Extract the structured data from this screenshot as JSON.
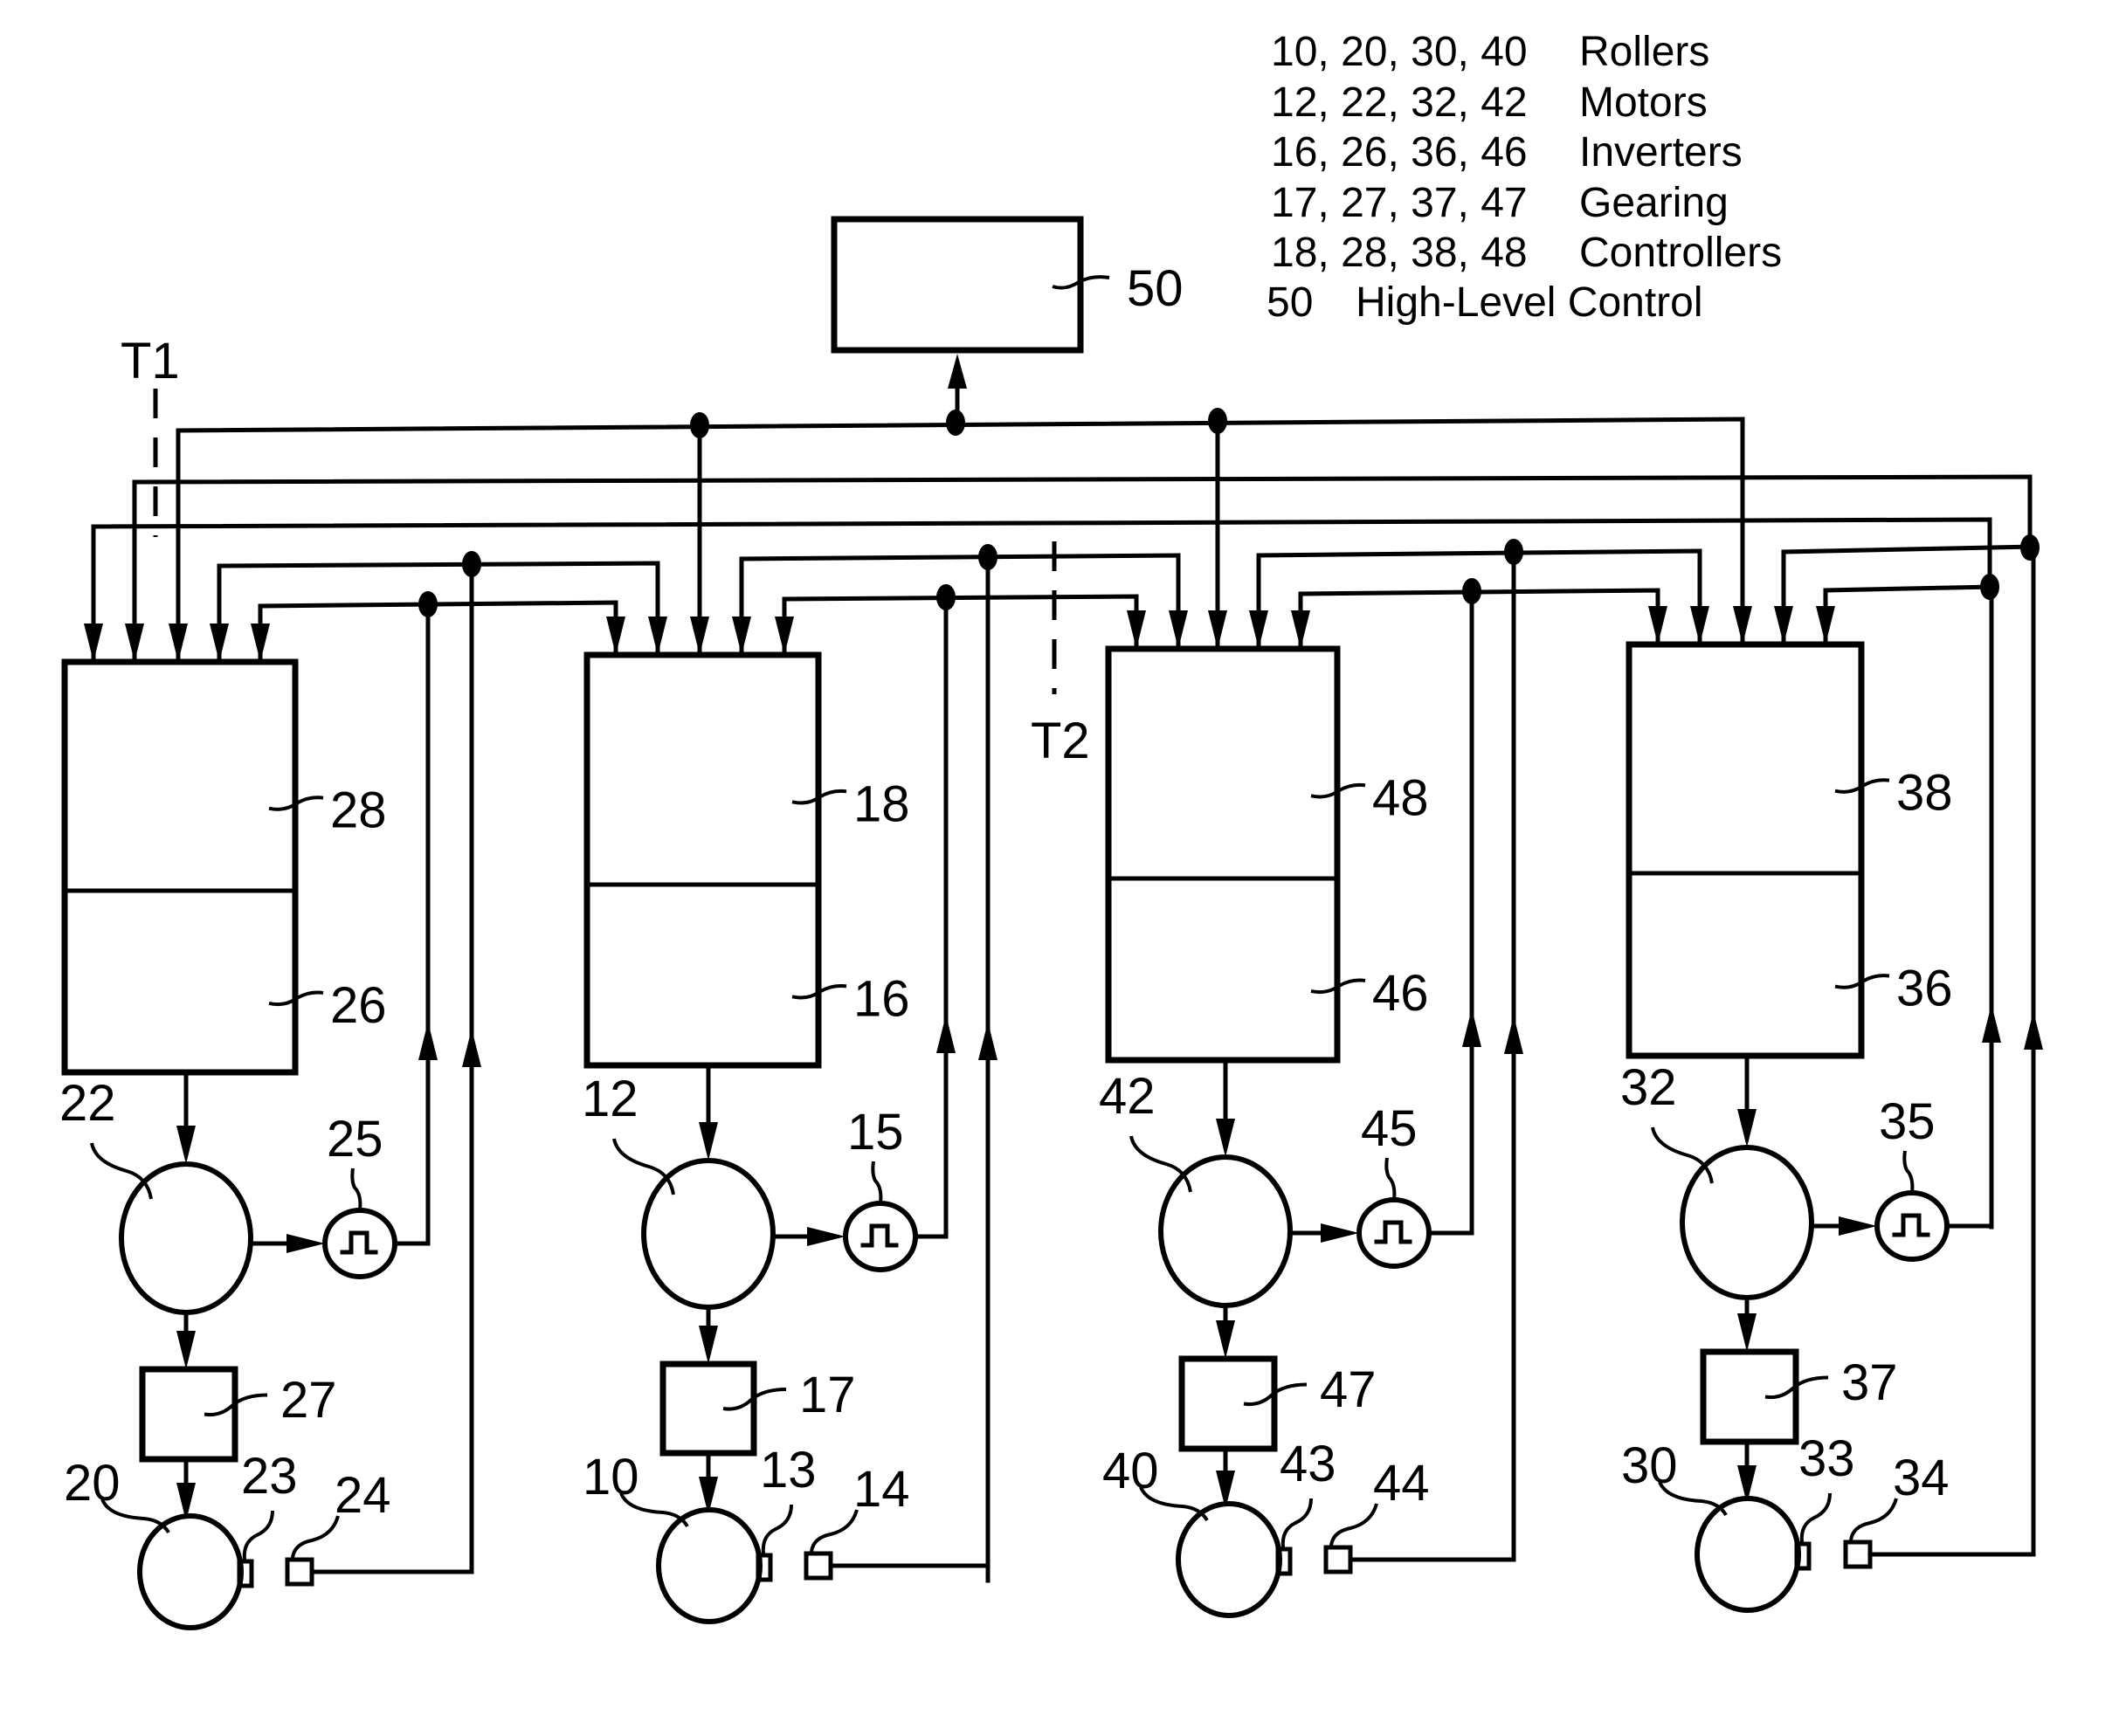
{
  "legend": [
    {
      "ids": "10, 20, 30, 40",
      "name": "Rollers"
    },
    {
      "ids": "12, 22, 32, 42",
      "name": "Motors"
    },
    {
      "ids": "16, 26, 36, 46",
      "name": "Inverters"
    },
    {
      "ids": "17, 27, 37, 47",
      "name": "Gearing"
    },
    {
      "ids": "18, 28, 38, 48",
      "name": "Controllers"
    },
    {
      "ids": "50",
      "name": "High-Level Control"
    }
  ],
  "high_level_control": {
    "label": "50"
  },
  "separators": [
    {
      "label": "T1"
    },
    {
      "label": "T2"
    }
  ],
  "units": [
    {
      "controller": "28",
      "inverter": "26",
      "motor": "22",
      "encoder": "25",
      "gearing": "27",
      "roller": "20",
      "roller_sensor": "23",
      "sensor": "24"
    },
    {
      "controller": "18",
      "inverter": "16",
      "motor": "12",
      "encoder": "15",
      "gearing": "17",
      "roller": "10",
      "roller_sensor": "13",
      "sensor": "14"
    },
    {
      "controller": "48",
      "inverter": "46",
      "motor": "42",
      "encoder": "45",
      "gearing": "47",
      "roller": "40",
      "roller_sensor": "43",
      "sensor": "44"
    },
    {
      "controller": "38",
      "inverter": "36",
      "motor": "32",
      "encoder": "35",
      "gearing": "37",
      "roller": "30",
      "roller_sensor": "33",
      "sensor": "34"
    }
  ]
}
